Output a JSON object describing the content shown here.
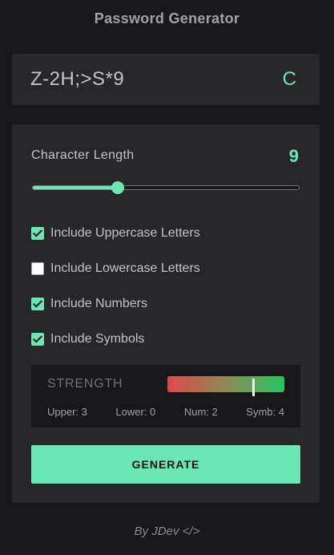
{
  "app": {
    "title": "Password Generator",
    "footer": "By JDev </>"
  },
  "password": {
    "value": "Z-2H;>S*9",
    "copy_label": "C"
  },
  "length": {
    "label": "Character Length",
    "value": "9",
    "slider_fraction": 0.32
  },
  "options": [
    {
      "label": "Include Uppercase Letters",
      "checked": true
    },
    {
      "label": "Include Lowercase Letters",
      "checked": false
    },
    {
      "label": "Include Numbers",
      "checked": true
    },
    {
      "label": "Include Symbols",
      "checked": true
    }
  ],
  "strength": {
    "label": "STRENGTH",
    "level_fraction": 0.73,
    "counts": {
      "upper": "Upper: 3",
      "lower": "Lower: 0",
      "num": "Num: 2",
      "symb": "Symb: 4"
    }
  },
  "generate": {
    "label": "GENERATE"
  },
  "colors": {
    "accent": "#6ce6b5",
    "background": "#18181b",
    "panel": "#27272a",
    "strength_low": "#e04848",
    "strength_high": "#22c55e"
  }
}
